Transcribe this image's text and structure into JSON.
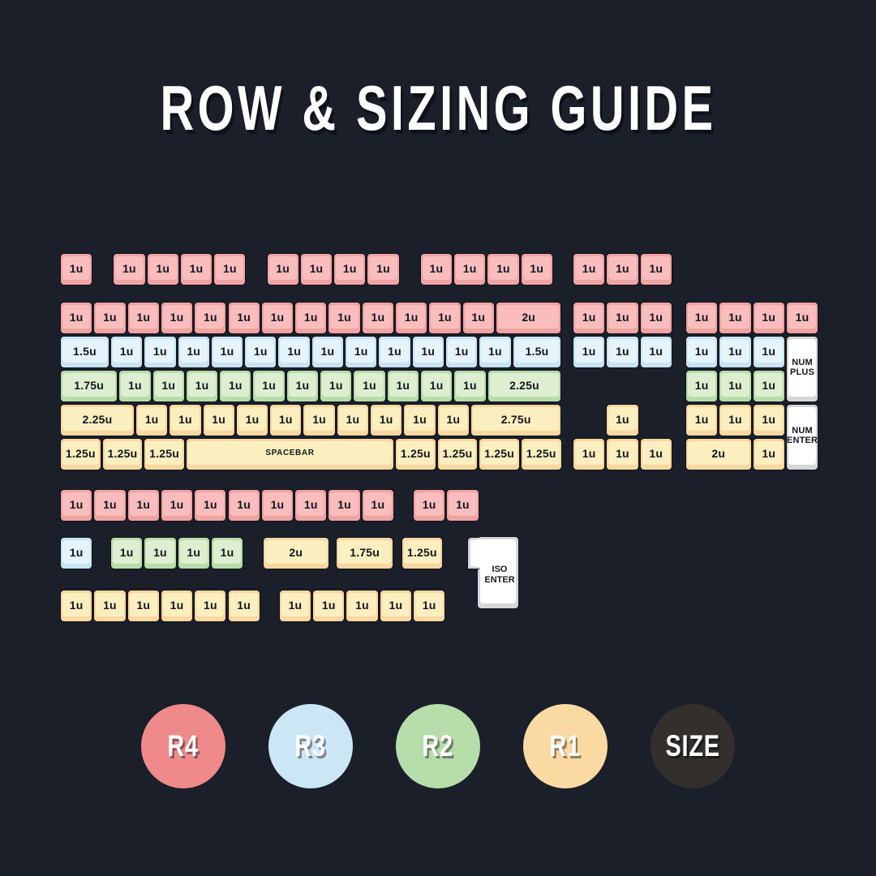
{
  "title": "ROW & SIZING GUIDE",
  "background_color": "#1b1f2a",
  "row_colors": {
    "r4_shell": "#f0a3a3",
    "r4_top": "#f9bdbd",
    "r3_shell": "#c7e4f2",
    "r3_top": "#e5f3fb",
    "r2_shell": "#b8dcaa",
    "r2_top": "#ddefd0",
    "r1_shell": "#fad7a0",
    "r1_top": "#fbefc0",
    "size_shell": "#d6d6d6",
    "size_top": "#ffffff"
  },
  "legend": [
    {
      "label": "R4",
      "color": "#f08a8a",
      "text_color": "#ffffff"
    },
    {
      "label": "R3",
      "color": "#cbe7f5",
      "text_color": "#ffffff"
    },
    {
      "label": "R2",
      "color": "#b6ddaa",
      "text_color": "#ffffff"
    },
    {
      "label": "R1",
      "color": "#fbd9a3",
      "text_color": "#ffffff"
    },
    {
      "label": "SIZE",
      "color": "#332f2d",
      "text_color": "#ffffff"
    }
  ],
  "keyboard": {
    "function_row": {
      "row": "R4",
      "groups": [
        {
          "keys": [
            "1u"
          ]
        },
        {
          "keys": [
            "1u",
            "1u",
            "1u",
            "1u"
          ]
        },
        {
          "keys": [
            "1u",
            "1u",
            "1u",
            "1u"
          ]
        },
        {
          "keys": [
            "1u",
            "1u",
            "1u",
            "1u"
          ]
        },
        {
          "keys": [
            "1u",
            "1u",
            "1u"
          ]
        }
      ]
    },
    "main_block": {
      "rows": [
        {
          "row": "R4",
          "keys": [
            "1u",
            "1u",
            "1u",
            "1u",
            "1u",
            "1u",
            "1u",
            "1u",
            "1u",
            "1u",
            "1u",
            "1u",
            "1u",
            "2u"
          ]
        },
        {
          "row": "R3",
          "keys": [
            "1.5u",
            "1u",
            "1u",
            "1u",
            "1u",
            "1u",
            "1u",
            "1u",
            "1u",
            "1u",
            "1u",
            "1u",
            "1u",
            "1.5u"
          ]
        },
        {
          "row": "R2",
          "keys": [
            "1.75u",
            "1u",
            "1u",
            "1u",
            "1u",
            "1u",
            "1u",
            "1u",
            "1u",
            "1u",
            "1u",
            "1u",
            "2.25u"
          ]
        },
        {
          "row": "R1",
          "keys": [
            "2.25u",
            "1u",
            "1u",
            "1u",
            "1u",
            "1u",
            "1u",
            "1u",
            "1u",
            "1u",
            "1u",
            "2.75u"
          ]
        },
        {
          "row": "R1",
          "keys": [
            "1.25u",
            "1.25u",
            "1.25u",
            "SPACEBAR",
            "1.25u",
            "1.25u",
            "1.25u",
            "1.25u"
          ]
        }
      ]
    },
    "nav_block": {
      "rows": [
        {
          "row": "R4",
          "keys": [
            "1u",
            "1u",
            "1u"
          ]
        },
        {
          "row": "R4",
          "keys": [
            "1u",
            "1u",
            "1u"
          ]
        },
        {
          "row": "R3",
          "keys": [
            "1u",
            "1u",
            "1u"
          ]
        },
        {
          "row": "R1",
          "keys": [
            "1u"
          ]
        },
        {
          "row": "R1",
          "keys": [
            "1u",
            "1u",
            "1u"
          ]
        }
      ]
    },
    "numpad_block": {
      "rows": [
        {
          "row": "R4",
          "keys": [
            "1u",
            "1u",
            "1u",
            "1u"
          ]
        },
        {
          "row": "R3",
          "keys": [
            "1u",
            "1u",
            "1u"
          ]
        },
        {
          "row": "R2",
          "keys": [
            "1u",
            "1u",
            "1u"
          ]
        },
        {
          "row": "R1",
          "keys": [
            "1u",
            "1u",
            "1u"
          ]
        },
        {
          "row": "R1",
          "keys": [
            "2u",
            "1u"
          ]
        }
      ],
      "tall_keys": [
        {
          "label_line1": "NUM",
          "label_line2": "PLUS"
        },
        {
          "label_line1": "NUM",
          "label_line2": "ENTER"
        }
      ]
    },
    "extras": {
      "row_a": {
        "row": "R4",
        "groups": [
          {
            "keys": [
              "1u",
              "1u",
              "1u",
              "1u",
              "1u",
              "1u",
              "1u",
              "1u",
              "1u",
              "1u"
            ]
          },
          {
            "keys": [
              "1u",
              "1u"
            ]
          }
        ]
      },
      "row_b": {
        "groups": [
          {
            "row": "R3",
            "keys": [
              "1u"
            ]
          },
          {
            "row": "R2",
            "keys": [
              "1u",
              "1u",
              "1u",
              "1u"
            ]
          },
          {
            "row": "R1",
            "keys": [
              "2u"
            ]
          },
          {
            "row": "R1",
            "keys": [
              "1.75u"
            ]
          },
          {
            "row": "R1",
            "keys": [
              "1.25u"
            ]
          }
        ],
        "iso_enter": {
          "label_line1": "ISO",
          "label_line2": "ENTER"
        }
      },
      "row_c": {
        "row": "R1",
        "groups": [
          {
            "keys": [
              "1u",
              "1u",
              "1u",
              "1u",
              "1u",
              "1u"
            ]
          },
          {
            "keys": [
              "1u",
              "1u",
              "1u",
              "1u",
              "1u"
            ]
          }
        ]
      }
    }
  }
}
